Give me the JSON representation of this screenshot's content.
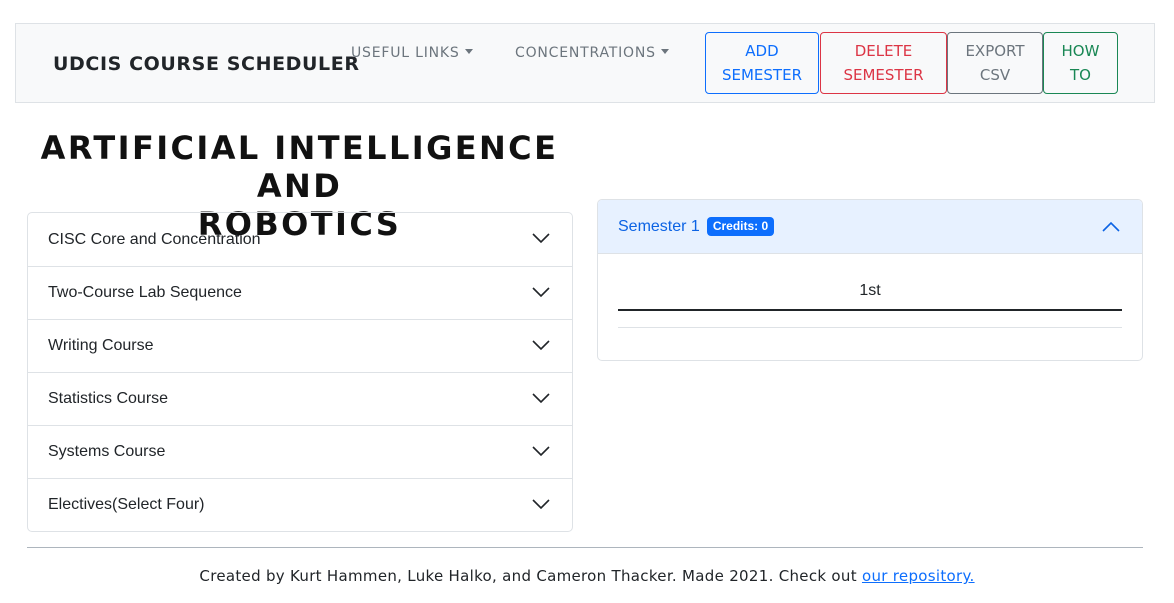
{
  "navbar": {
    "brand": "UDCIS COURSE SCHEDULER",
    "links": [
      {
        "label": "USEFUL LINKS"
      },
      {
        "label": "CONCENTRATIONS"
      }
    ],
    "buttons": {
      "add_semester": [
        "ADD",
        "SEMESTER"
      ],
      "delete_semester": [
        "DELETE",
        "SEMESTER"
      ],
      "export_csv": [
        "EXPORT",
        "CSV"
      ],
      "how_to": [
        "HOW",
        "TO"
      ]
    }
  },
  "concentration": {
    "title_line1": "ARTIFICIAL INTELLIGENCE AND",
    "title_line2": "ROBOTICS"
  },
  "requirements": [
    {
      "label": "CISC Core and Concentration"
    },
    {
      "label": "Two-Course Lab Sequence"
    },
    {
      "label": "Writing Course"
    },
    {
      "label": "Statistics Course"
    },
    {
      "label": "Systems Course"
    },
    {
      "label": "Electives(Select Four)"
    }
  ],
  "semester": {
    "title": "Semester 1",
    "credits_badge": "Credits: 0",
    "column_header": "1st"
  },
  "footer": {
    "text": "Created by Kurt Hammen, Luke Halko, and Cameron Thacker. Made 2021. Check out",
    "link_text": "our repository."
  },
  "colors": {
    "primary": "#0d6efd",
    "danger": "#dc3545",
    "secondary": "#6c757d",
    "success": "#198754",
    "accordion_header_bg": "#e7f1ff"
  },
  "icons": {
    "caret": "caret-down-icon",
    "accordion": "chevron-down-icon",
    "semester": "chevron-up-icon"
  }
}
